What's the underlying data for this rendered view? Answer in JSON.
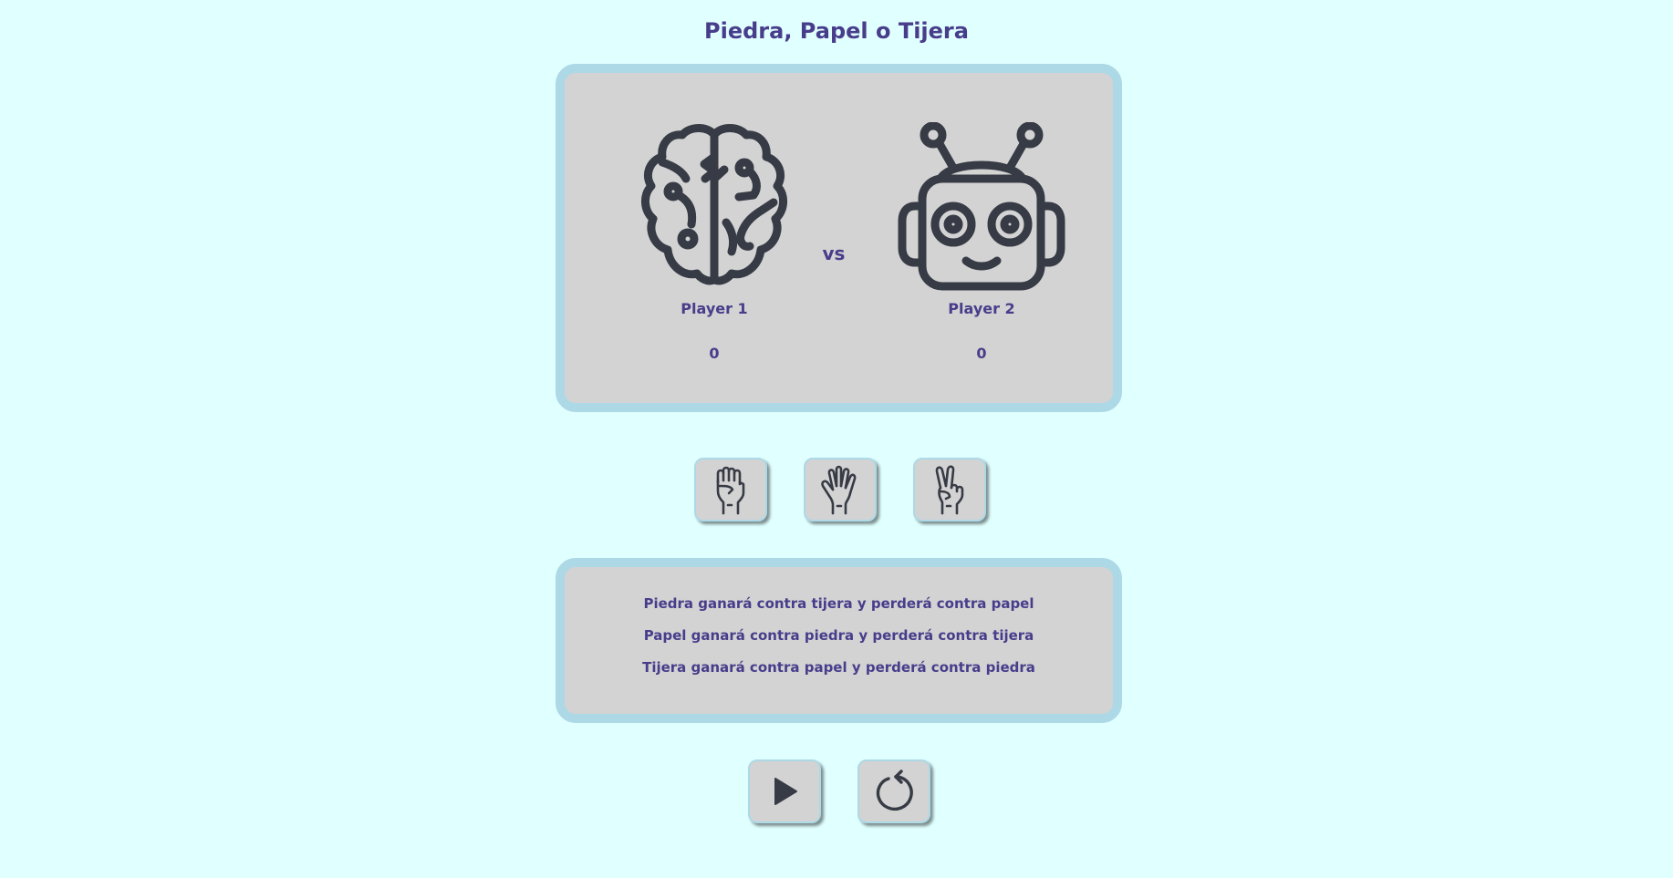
{
  "title": "Piedra, Papel o Tijera",
  "board": {
    "player1": {
      "name": "Player 1",
      "score": "0",
      "icon": "brain-icon"
    },
    "vs": "vs",
    "player2": {
      "name": "Player 2",
      "score": "0",
      "icon": "robot-icon"
    }
  },
  "choices": [
    {
      "name": "piedra",
      "icon": "fist-icon"
    },
    {
      "name": "papel",
      "icon": "open-hand-icon"
    },
    {
      "name": "tijera",
      "icon": "victory-hand-icon"
    }
  ],
  "rules": [
    "Piedra ganará contra tijera y perderá contra papel",
    "Papel ganará contra piedra y perderá contra tijera",
    "Tijera ganará contra papel y perderá contra piedra"
  ],
  "controls": [
    {
      "name": "play",
      "icon": "play-icon"
    },
    {
      "name": "reset",
      "icon": "reset-icon"
    }
  ],
  "colors": {
    "background": "#e0ffff",
    "panel": "#d3d3d3",
    "panel_border": "#add8e6",
    "text": "#483d8b",
    "icon": "#373b45"
  }
}
